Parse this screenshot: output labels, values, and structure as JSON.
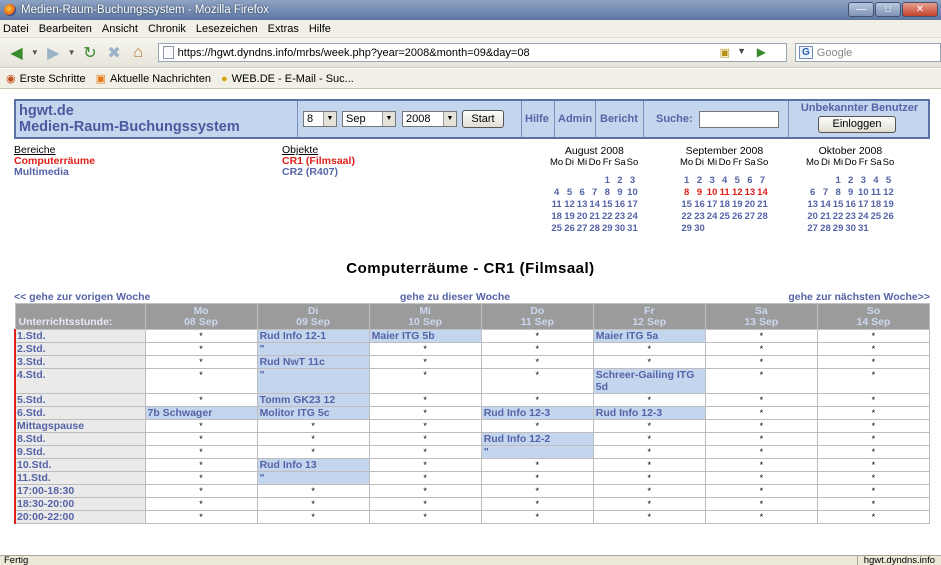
{
  "window": {
    "title": "Medien-Raum-Buchungssystem - Mozilla Firefox"
  },
  "menu": [
    "Datei",
    "Bearbeiten",
    "Ansicht",
    "Chronik",
    "Lesezeichen",
    "Extras",
    "Hilfe"
  ],
  "nav": {
    "url": "https://hgwt.dyndns.info/mrbs/week.php?year=2008&month=09&day=08",
    "search_placeholder": "Google",
    "search_engine_icon": "G"
  },
  "bookmarks": [
    "Erste Schritte",
    "Aktuelle Nachrichten",
    "WEB.DE - E-Mail - Suc..."
  ],
  "banner": {
    "site_name": "hgwt.de",
    "system_name": "Medien-Raum-Buchungssystem",
    "day": "8",
    "month": "Sep",
    "year": "2008",
    "start_label": "Start",
    "help": "Hilfe",
    "admin": "Admin",
    "report": "Bericht",
    "search_label": "Suche:",
    "unknown_user": "Unbekannter Benutzer",
    "login_label": "Einloggen"
  },
  "areas": {
    "header": "Bereiche",
    "items": [
      "Computerräume",
      "Multimedia"
    ],
    "selected": 0
  },
  "objects": {
    "header": "Objekte",
    "items": [
      "CR1 (Filmsaal)",
      "CR2 (R407)"
    ],
    "selected": 0
  },
  "calendars": [
    {
      "title": "August 2008",
      "head": [
        "Mo",
        "Di",
        "Mi",
        "Do",
        "Fr",
        "Sa",
        "So"
      ],
      "weeks": [
        [
          "",
          "",
          "",
          "",
          "1",
          "2",
          "3"
        ],
        [
          "4",
          "5",
          "6",
          "7",
          "8",
          "9",
          "10"
        ],
        [
          "11",
          "12",
          "13",
          "14",
          "15",
          "16",
          "17"
        ],
        [
          "18",
          "19",
          "20",
          "21",
          "22",
          "23",
          "24"
        ],
        [
          "25",
          "26",
          "27",
          "28",
          "29",
          "30",
          "31"
        ]
      ]
    },
    {
      "title": "September 2008",
      "head": [
        "Mo",
        "Di",
        "Mi",
        "Do",
        "Fr",
        "Sa",
        "So"
      ],
      "weeks": [
        [
          "1",
          "2",
          "3",
          "4",
          "5",
          "6",
          "7"
        ],
        [
          "8",
          "9",
          "10",
          "11",
          "12",
          "13",
          "14"
        ],
        [
          "15",
          "16",
          "17",
          "18",
          "19",
          "20",
          "21"
        ],
        [
          "22",
          "23",
          "24",
          "25",
          "26",
          "27",
          "28"
        ],
        [
          "29",
          "30",
          "",
          "",
          "",
          "",
          ""
        ]
      ],
      "highlight_week": 1
    },
    {
      "title": "Oktober 2008",
      "head": [
        "Mo",
        "Di",
        "Mi",
        "Do",
        "Fr",
        "Sa",
        "So"
      ],
      "weeks": [
        [
          "",
          "",
          "1",
          "2",
          "3",
          "4",
          "5"
        ],
        [
          "6",
          "7",
          "8",
          "9",
          "10",
          "11",
          "12"
        ],
        [
          "13",
          "14",
          "15",
          "16",
          "17",
          "18",
          "19"
        ],
        [
          "20",
          "21",
          "22",
          "23",
          "24",
          "25",
          "26"
        ],
        [
          "27",
          "28",
          "29",
          "30",
          "31",
          "",
          ""
        ]
      ]
    }
  ],
  "room_title": "Computerräume - CR1 (Filmsaal)",
  "week_nav": {
    "prev": "<< gehe zur vorigen Woche",
    "current": "gehe zu dieser Woche",
    "next": "gehe zur nächsten Woche>>"
  },
  "grid": {
    "corner": "Unterrichtsstunde:",
    "days": [
      {
        "d": "Mo",
        "date": "08 Sep"
      },
      {
        "d": "Di",
        "date": "09 Sep"
      },
      {
        "d": "Mi",
        "date": "10 Sep"
      },
      {
        "d": "Do",
        "date": "11 Sep"
      },
      {
        "d": "Fr",
        "date": "12 Sep"
      },
      {
        "d": "Sa",
        "date": "13 Sep"
      },
      {
        "d": "So",
        "date": "14 Sep"
      }
    ],
    "empty_marker": "*",
    "rows": [
      {
        "p": "1.Std.",
        "c": [
          "*",
          "Rud Info 12-1",
          "Maier ITG 5b",
          "*",
          "Maier ITG 5a",
          "*",
          "*"
        ]
      },
      {
        "p": "2.Std.",
        "c": [
          "*",
          "\"",
          "*",
          "*",
          "*",
          "*",
          "*"
        ]
      },
      {
        "p": "3.Std.",
        "c": [
          "*",
          "Rud NwT 11c",
          "*",
          "*",
          "*",
          "*",
          "*"
        ]
      },
      {
        "p": "4.Std.",
        "c": [
          "*",
          "\"",
          "*",
          "*",
          "Schreer-Gailing ITG 5d",
          "*",
          "*"
        ],
        "tall": true
      },
      {
        "p": "5.Std.",
        "c": [
          "*",
          "Tomm GK23 12",
          "*",
          "*",
          "*",
          "*",
          "*"
        ]
      },
      {
        "p": "6.Std.",
        "c": [
          "7b Schwager",
          "Molitor ITG 5c",
          "*",
          "Rud Info 12-3",
          "Rud Info 12-3",
          "*",
          "*"
        ]
      },
      {
        "p": "Mittagspause",
        "c": [
          "*",
          "*",
          "*",
          "*",
          "*",
          "*",
          "*"
        ]
      },
      {
        "p": "8.Std.",
        "c": [
          "*",
          "*",
          "*",
          "Rud Info 12-2",
          "*",
          "*",
          "*"
        ]
      },
      {
        "p": "9.Std.",
        "c": [
          "*",
          "*",
          "*",
          "\"",
          "*",
          "*",
          "*"
        ]
      },
      {
        "p": "10.Std.",
        "c": [
          "*",
          "Rud Info 13",
          "*",
          "*",
          "*",
          "*",
          "*"
        ]
      },
      {
        "p": "11.Std.",
        "c": [
          "*",
          "\"",
          "*",
          "*",
          "*",
          "*",
          "*"
        ]
      },
      {
        "p": "17:00-18:30",
        "c": [
          "*",
          "*",
          "*",
          "*",
          "*",
          "*",
          "*"
        ]
      },
      {
        "p": "18:30-20:00",
        "c": [
          "*",
          "*",
          "*",
          "*",
          "*",
          "*",
          "*"
        ]
      },
      {
        "p": "20:00-22:00",
        "c": [
          "*",
          "*",
          "*",
          "*",
          "*",
          "*",
          "*"
        ]
      }
    ]
  },
  "status": {
    "left": "Fertig",
    "right": "hgwt.dyndns.info"
  }
}
